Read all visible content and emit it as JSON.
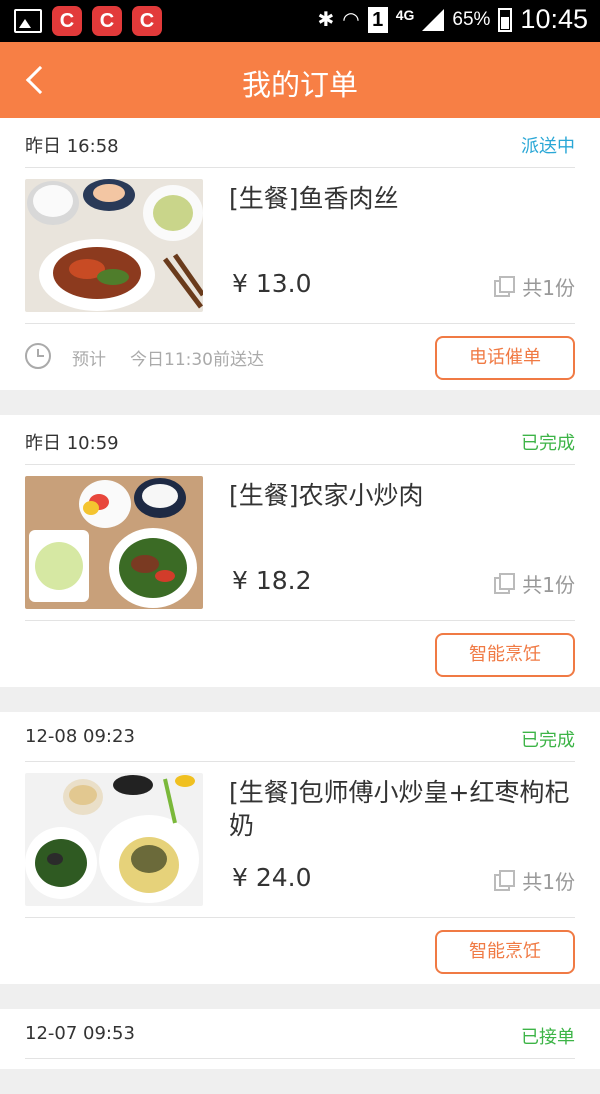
{
  "status_bar": {
    "app_icons": [
      "C",
      "C",
      "C"
    ],
    "network": "4G",
    "sim": "1",
    "battery": "65%",
    "time": "10:45"
  },
  "header": {
    "title": "我的订单"
  },
  "orders": [
    {
      "time": "昨日  16:58",
      "status": "派送中",
      "status_color": "#2aa7d6",
      "name": "[生餐]鱼香肉丝",
      "price": "¥ 13.0",
      "qty": "共1份",
      "eta_label": "预计",
      "eta_text": "今日11:30前送达",
      "action": "电话催单"
    },
    {
      "time": "昨日  10:59",
      "status": "已完成",
      "status_color": "#3db447",
      "name": "[生餐]农家小炒肉",
      "price": "¥ 18.2",
      "qty": "共1份",
      "action": "智能烹饪"
    },
    {
      "time": "12-08 09:23",
      "status": "已完成",
      "status_color": "#3db447",
      "name": "[生餐]包师傅小炒皇+红枣枸杞奶",
      "price": "¥ 24.0",
      "qty": "共1份",
      "action": "智能烹饪"
    },
    {
      "time": "12-07 09:53",
      "status": "已接单",
      "status_color": "#3db447"
    }
  ],
  "colors": {
    "accent": "#f77f45",
    "button": "#f07a44"
  }
}
